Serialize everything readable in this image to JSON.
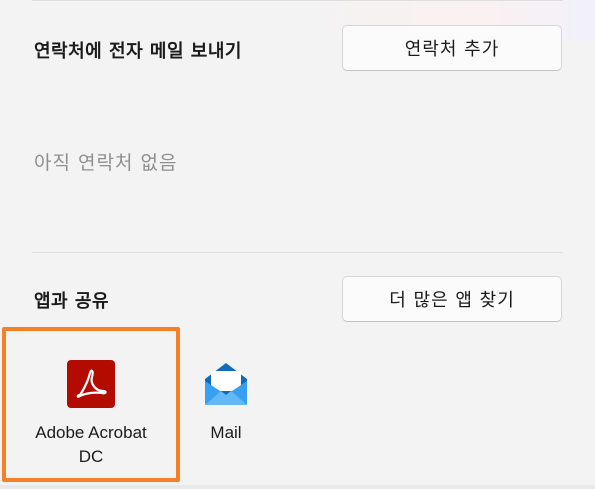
{
  "email_section": {
    "title": "연락처에 전자 메일 보내기",
    "add_contact_label": "연락처 추가",
    "empty_text": "아직 연락처 없음"
  },
  "share_section": {
    "title": "앱과 공유",
    "find_more_label": "더 많은 앱 찾기",
    "apps": [
      {
        "label_line1": "Adobe Acrobat",
        "label_line2": "DC",
        "icon": "adobe-acrobat-icon",
        "selected": true
      },
      {
        "label_line1": "Mail",
        "icon": "mail-icon",
        "selected": false
      }
    ]
  },
  "colors": {
    "highlight": "#f58025",
    "acrobat_red": "#b30b00",
    "mail_blue": "#0f6cbd"
  }
}
